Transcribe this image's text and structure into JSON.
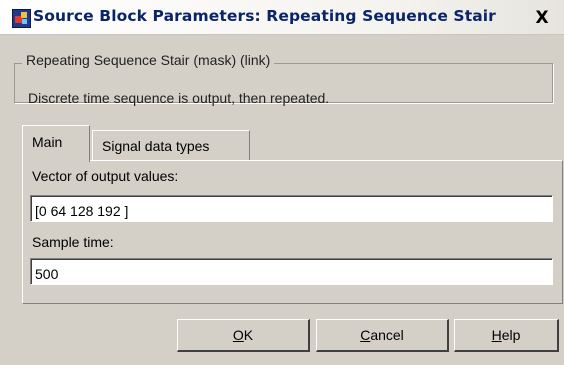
{
  "window": {
    "title": "Source Block Parameters: Repeating Sequence Stair",
    "close_glyph": "X"
  },
  "group": {
    "legend": "Repeating Sequence Stair (mask) (link)",
    "description": "Discrete time sequence is output, then repeated."
  },
  "tabs": [
    {
      "label": "Main",
      "selected": true
    },
    {
      "label": "Signal data types",
      "selected": false
    }
  ],
  "fields": {
    "vector_label": "Vector of output values:",
    "vector_value": "[0 64 128 192 ]",
    "sample_label": "Sample time:",
    "sample_value": "500"
  },
  "buttons": {
    "ok": {
      "mnemonic": "O",
      "rest": "K"
    },
    "cancel": {
      "mnemonic": "C",
      "rest": "ancel"
    },
    "help": {
      "mnemonic": "H",
      "rest": "elp"
    }
  },
  "colors": {
    "title_text": "#0a246a",
    "dialog_face": "#d4d0c8"
  }
}
